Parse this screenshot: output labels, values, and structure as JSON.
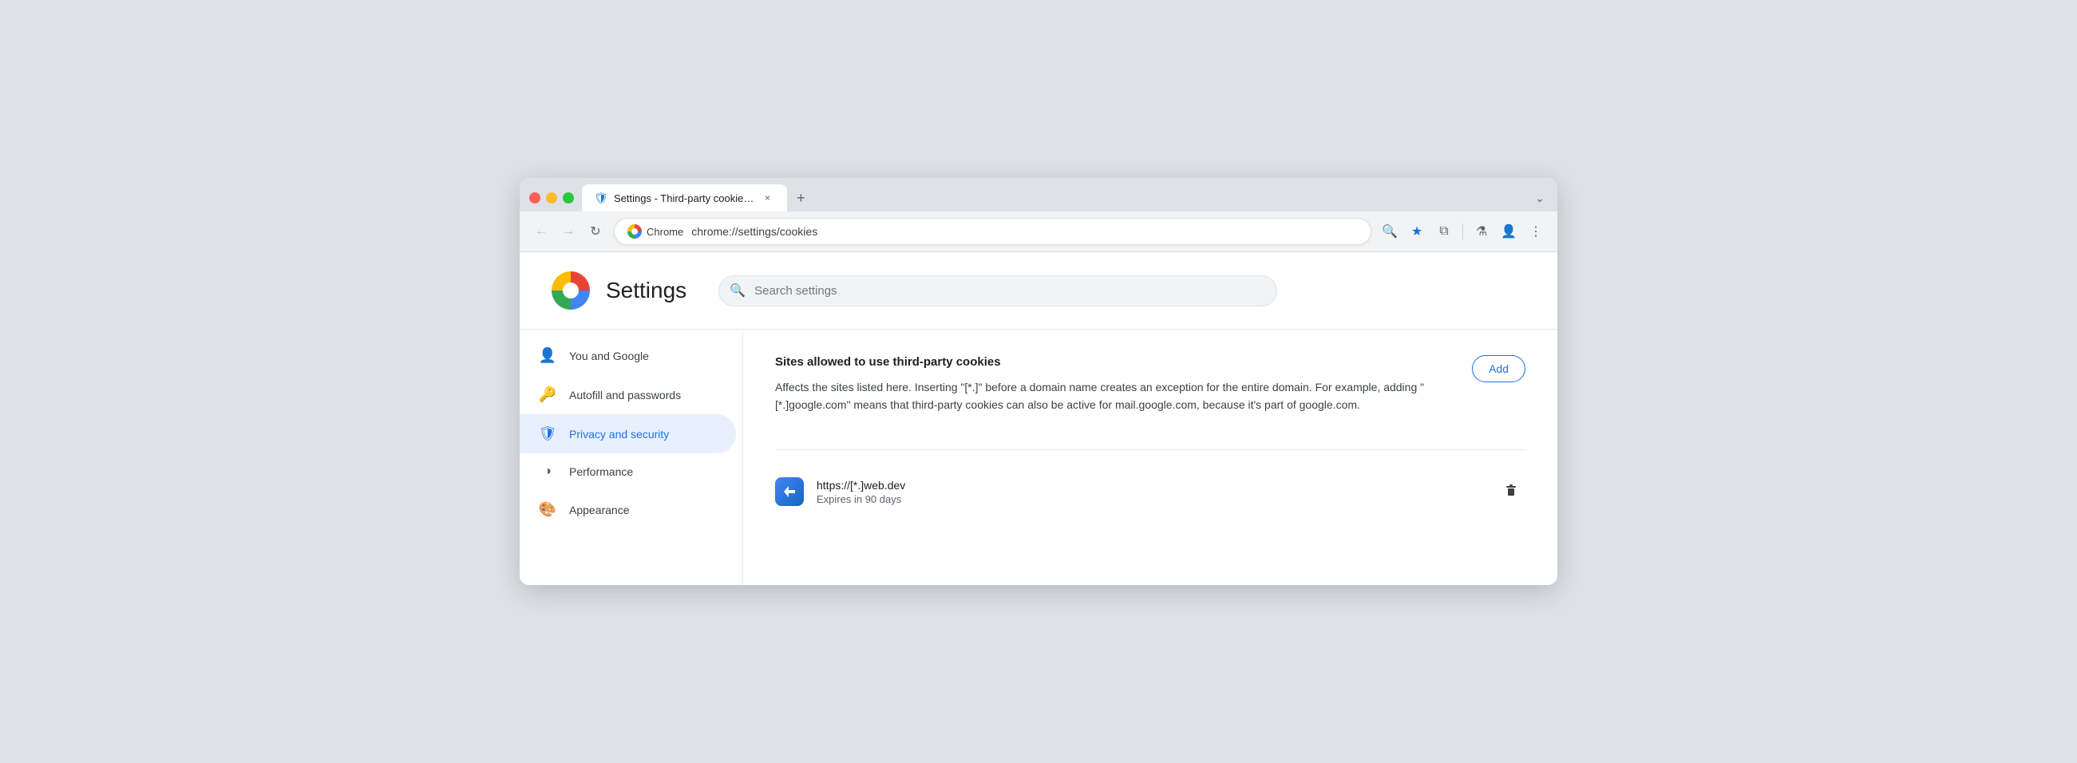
{
  "browser": {
    "tab": {
      "favicon": "⚙",
      "label": "Settings - Third-party cookie…",
      "close": "×"
    },
    "tab_new": "+",
    "tab_expand": "⌄",
    "nav": {
      "back": "←",
      "forward": "→",
      "reload": "↻"
    },
    "omnibox": {
      "brand": "Chrome",
      "url": "chrome://settings/cookies"
    },
    "actions": {
      "zoom": "🔍",
      "star": "★",
      "extensions": "⧉",
      "experiments": "⚗",
      "profile": "👤",
      "menu": "⋮"
    }
  },
  "settings": {
    "logo_alt": "Chrome settings logo",
    "title": "Settings",
    "search_placeholder": "Search settings",
    "sidebar": {
      "items": [
        {
          "id": "you-and-google",
          "icon": "👤",
          "label": "You and Google",
          "active": false
        },
        {
          "id": "autofill",
          "icon": "🔑",
          "label": "Autofill and passwords",
          "active": false
        },
        {
          "id": "privacy-security",
          "icon": "🛡",
          "label": "Privacy and security",
          "active": true
        },
        {
          "id": "performance",
          "icon": "◑",
          "label": "Performance",
          "active": false
        },
        {
          "id": "appearance",
          "icon": "🎨",
          "label": "Appearance",
          "active": false
        }
      ]
    },
    "main": {
      "section_title": "Sites allowed to use third-party cookies",
      "section_desc": "Affects the sites listed here. Inserting \"[*.]\" before a domain name creates an exception for the entire domain. For example, adding \"[*.]google.com\" means that third-party cookies can also be active for mail.google.com, because it's part of google.com.",
      "add_button": "Add",
      "cookie_entry": {
        "url": "https://[*.]web.dev",
        "expires": "Expires in 90 days",
        "icon": "▶",
        "delete_icon": "🗑"
      }
    }
  }
}
